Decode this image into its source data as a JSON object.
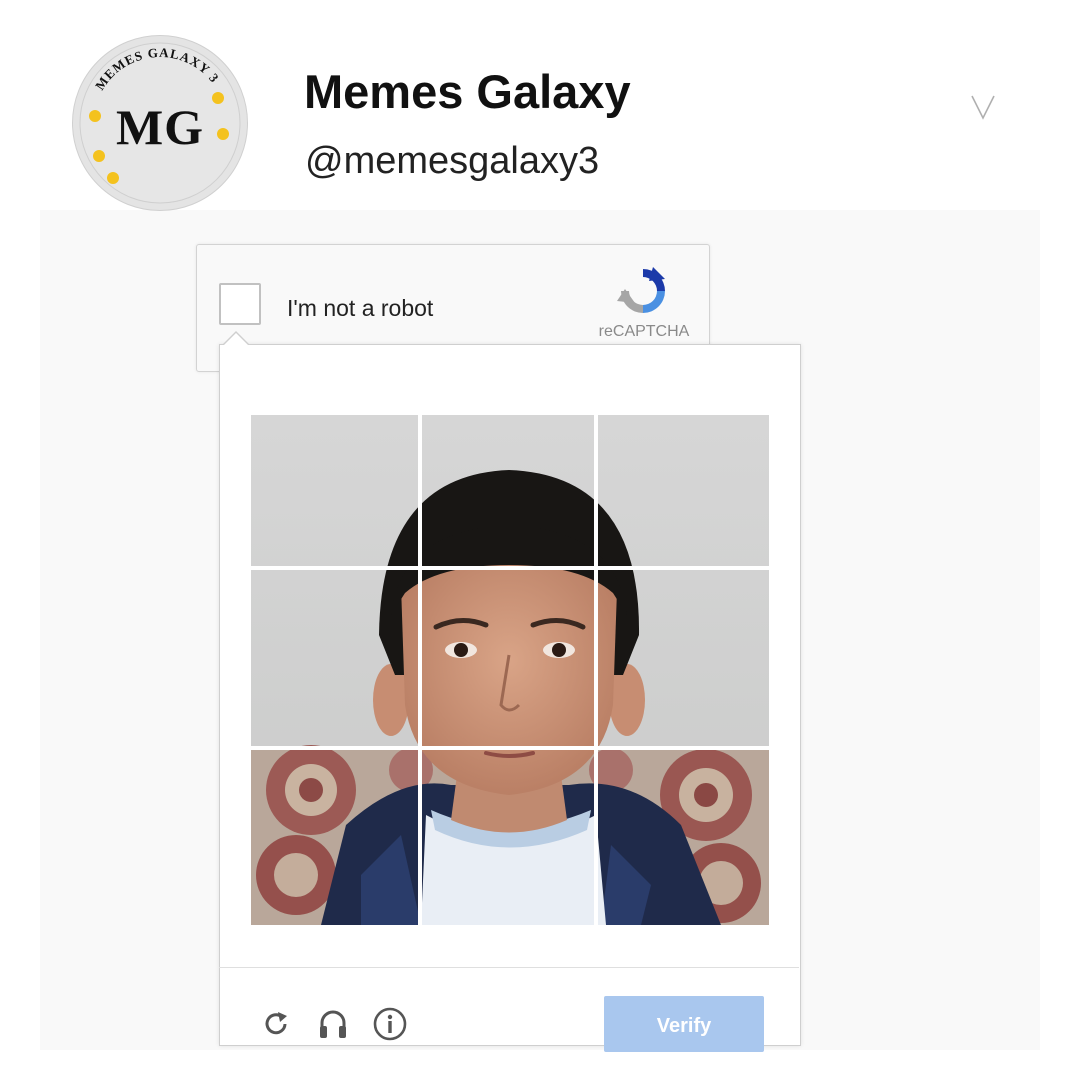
{
  "profile": {
    "name": "Memes Galaxy",
    "handle": "@memesgalaxy3",
    "avatar_monogram": "MG",
    "avatar_ring_text": "MEMES GALAXY 3"
  },
  "recaptcha": {
    "checkbox_label": "I'm not a robot",
    "brand": "reCAPTCHA",
    "verify_label": "Verify",
    "grid_rows": 3,
    "grid_cols": 3,
    "footer_icons": [
      "reload-icon",
      "headphones-icon",
      "info-icon"
    ]
  },
  "colors": {
    "verify_button": "#a9c7ee",
    "recaptcha_blue": "#4a90e2",
    "recaptcha_gray": "#a6a6a6"
  }
}
